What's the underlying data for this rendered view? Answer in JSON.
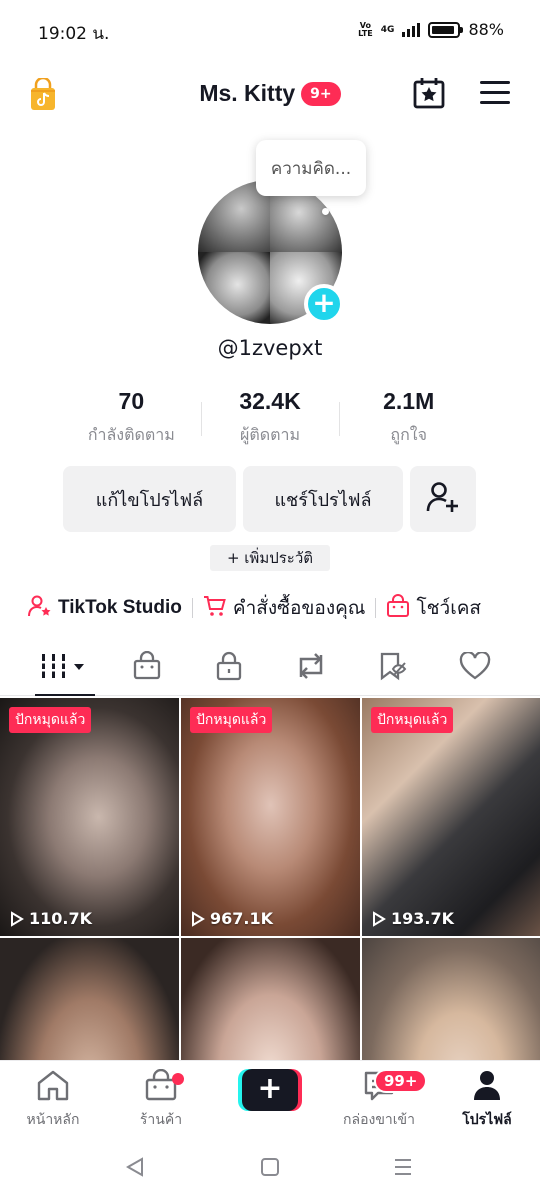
{
  "status_bar": {
    "time": "19:02 น.",
    "volte_line1": "Vo",
    "volte_line2": "LTE",
    "network": "4G",
    "battery_percent": "88%",
    "battery_level": 0.88
  },
  "header": {
    "profile_name": "Ms. Kitty",
    "notification_badge": "9+",
    "shop_icon": "tiktok-shop-bag-icon",
    "calendar_icon": "calendar-star-icon",
    "menu_icon": "hamburger-menu-icon"
  },
  "profile": {
    "thought_bubble": "ความคิด...",
    "username": "@1zvepxt",
    "add_avatar_symbol": "+"
  },
  "stats": [
    {
      "value": "70",
      "label": "กำลังติดตาม"
    },
    {
      "value": "32.4K",
      "label": "ผู้ติดตาม"
    },
    {
      "value": "2.1M",
      "label": "ถูกใจ"
    }
  ],
  "actions": {
    "edit_profile": "แก้ไขโปรไฟล์",
    "share_profile": "แชร์โปรไฟล์",
    "add_friend_icon": "add-user-icon"
  },
  "bio": {
    "add_bio": "+ เพิ่มประวัติ"
  },
  "shortcuts": [
    {
      "label": "TikTok Studio",
      "icon": "person-star-icon"
    },
    {
      "label": "คำสั่งซื้อของคุณ",
      "icon": "shopping-cart-icon"
    },
    {
      "label": "โชว์เคส",
      "icon": "shopping-bag-icon"
    }
  ],
  "tabs": [
    {
      "icon": "videos-grid-icon",
      "active": true
    },
    {
      "icon": "shop-bag-icon",
      "active": false
    },
    {
      "icon": "lock-icon",
      "active": false
    },
    {
      "icon": "repost-icon",
      "active": false
    },
    {
      "icon": "favorites-bookmark-icon",
      "active": false
    },
    {
      "icon": "liked-heart-icon",
      "active": false
    }
  ],
  "videos": [
    {
      "pinned_label": "ปักหมุดแล้ว",
      "views": "110.7K"
    },
    {
      "pinned_label": "ปักหมุดแล้ว",
      "views": "967.1K"
    },
    {
      "pinned_label": "ปักหมุดแล้ว",
      "views": "193.7K"
    },
    {
      "pinned_label": "",
      "views": ""
    },
    {
      "pinned_label": "",
      "views": ""
    },
    {
      "pinned_label": "",
      "views": ""
    }
  ],
  "bottom_nav": {
    "home": "หน้าหลัก",
    "shop": "ร้านค้า",
    "create": "+",
    "inbox": "กล่องขาเข้า",
    "inbox_badge": "99+",
    "profile": "โปรไฟล์"
  },
  "colors": {
    "accent_red": "#fe2c55",
    "accent_cyan": "#25f4ee",
    "text_primary": "#161823",
    "text_secondary": "#8a8b91",
    "button_bg": "#f1f1f2"
  }
}
